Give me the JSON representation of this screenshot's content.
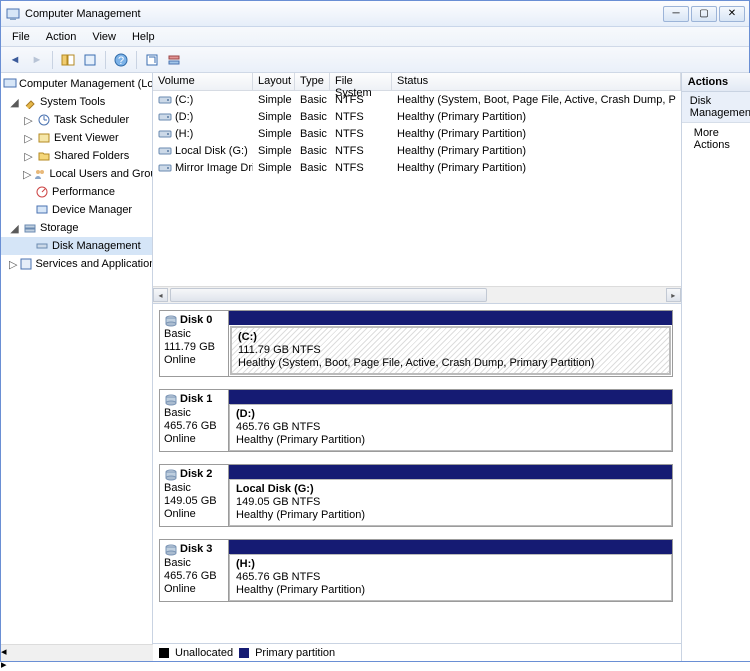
{
  "window": {
    "title": "Computer Management"
  },
  "menu": {
    "file": "File",
    "action": "Action",
    "view": "View",
    "help": "Help"
  },
  "tree": {
    "root": "Computer Management (Local)",
    "systools": "System Tools",
    "task": "Task Scheduler",
    "event": "Event Viewer",
    "shared": "Shared Folders",
    "users": "Local Users and Groups",
    "perf": "Performance",
    "devmgr": "Device Manager",
    "storage": "Storage",
    "diskmgmt": "Disk Management",
    "services": "Services and Applications"
  },
  "cols": {
    "vol": "Volume",
    "lay": "Layout",
    "typ": "Type",
    "fs": "File System",
    "st": "Status"
  },
  "volumes": [
    {
      "name": "(C:)",
      "layout": "Simple",
      "type": "Basic",
      "fs": "NTFS",
      "status": "Healthy (System, Boot, Page File, Active, Crash Dump, P"
    },
    {
      "name": "(D:)",
      "layout": "Simple",
      "type": "Basic",
      "fs": "NTFS",
      "status": "Healthy (Primary Partition)"
    },
    {
      "name": "(H:)",
      "layout": "Simple",
      "type": "Basic",
      "fs": "NTFS",
      "status": "Healthy (Primary Partition)"
    },
    {
      "name": "Local Disk (G:)",
      "layout": "Simple",
      "type": "Basic",
      "fs": "NTFS",
      "status": "Healthy (Primary Partition)"
    },
    {
      "name": "Mirror Image Drive (J:)",
      "layout": "Simple",
      "type": "Basic",
      "fs": "NTFS",
      "status": "Healthy (Primary Partition)"
    }
  ],
  "disks": [
    {
      "name": "Disk 0",
      "type": "Basic",
      "size": "111.79 GB",
      "state": "Online",
      "plabel": "(C:)",
      "pinfo": "111.79 GB NTFS",
      "pstatus": "Healthy (System, Boot, Page File, Active, Crash Dump, Primary Partition)",
      "hatch": true
    },
    {
      "name": "Disk 1",
      "type": "Basic",
      "size": "465.76 GB",
      "state": "Online",
      "plabel": "(D:)",
      "pinfo": "465.76 GB NTFS",
      "pstatus": "Healthy (Primary Partition)",
      "hatch": false
    },
    {
      "name": "Disk 2",
      "type": "Basic",
      "size": "149.05 GB",
      "state": "Online",
      "plabel": "Local Disk  (G:)",
      "pinfo": "149.05 GB NTFS",
      "pstatus": "Healthy (Primary Partition)",
      "hatch": false
    },
    {
      "name": "Disk 3",
      "type": "Basic",
      "size": "465.76 GB",
      "state": "Online",
      "plabel": "(H:)",
      "pinfo": "465.76 GB NTFS",
      "pstatus": "Healthy (Primary Partition)",
      "hatch": false
    }
  ],
  "legend": {
    "unalloc": "Unallocated",
    "primary": "Primary partition"
  },
  "actions": {
    "header": "Actions",
    "section": "Disk Management",
    "more": "More Actions"
  }
}
